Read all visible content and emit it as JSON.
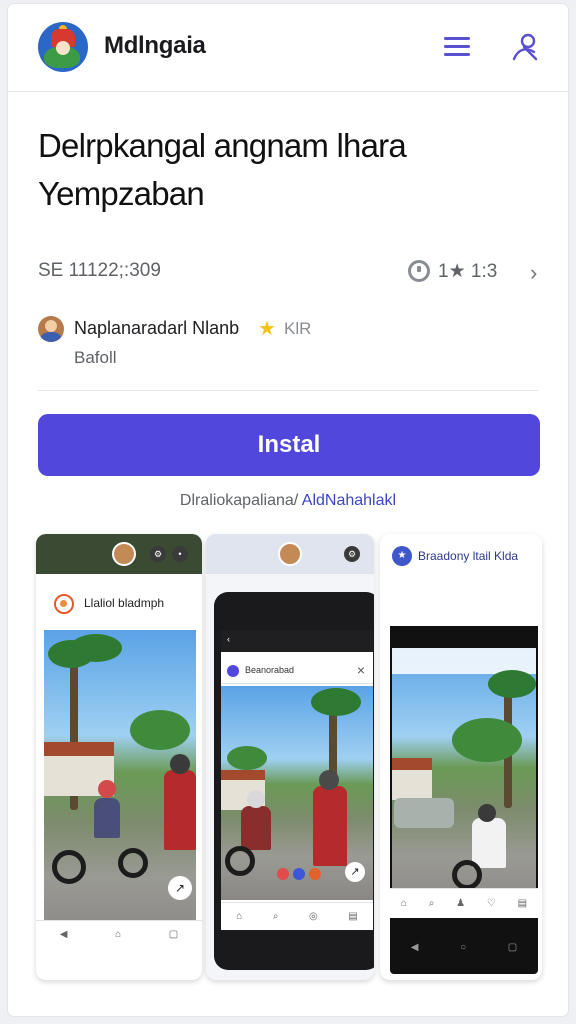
{
  "app": {
    "name": "Mdlngaia",
    "logo_icon": "app-logo-icon"
  },
  "header": {
    "menu_icon": "list-menu-icon",
    "account_icon": "person-icon"
  },
  "listing": {
    "title_line1": "Delrpkangal angnam lhara",
    "title_line2": "Yempzaban",
    "meta": "SE 11122;:309",
    "rating_text": "1★ 1:3",
    "developer": {
      "name": "Naplanaradarl Nlanb",
      "badge": "KlR",
      "sub": "Bafoll"
    },
    "install_label": "Instal",
    "note_prefix": "Dlraliokapaliana/",
    "note_link": "AldNahahlakl"
  },
  "screens": [
    {
      "label": "Llaliol bladmph"
    },
    {
      "label": "Beanorabad"
    },
    {
      "label": "Braadony ltail Klda"
    }
  ],
  "colors": {
    "accent": "#5147dc",
    "link": "#3b46c4",
    "star": "#f5c21b"
  }
}
